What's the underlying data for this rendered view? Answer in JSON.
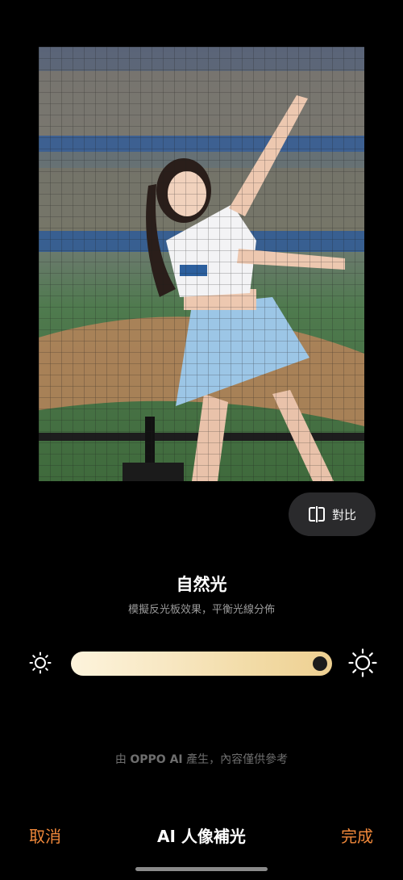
{
  "compare": {
    "label": "對比",
    "icon": "compare-icon"
  },
  "effect": {
    "title": "自然光",
    "description": "模擬反光板效果，平衡光線分佈"
  },
  "slider": {
    "value": 1.0,
    "low_icon": "sun-small-icon",
    "high_icon": "sun-large-icon"
  },
  "ai_note": {
    "prefix": "由 ",
    "brand": "OPPO AI",
    "suffix": " 產生，內容僅供參考"
  },
  "bottom_bar": {
    "cancel_label": "取消",
    "title": "AI 人像補光",
    "done_label": "完成"
  },
  "colors": {
    "accent": "#f0883a",
    "background": "#000000"
  }
}
